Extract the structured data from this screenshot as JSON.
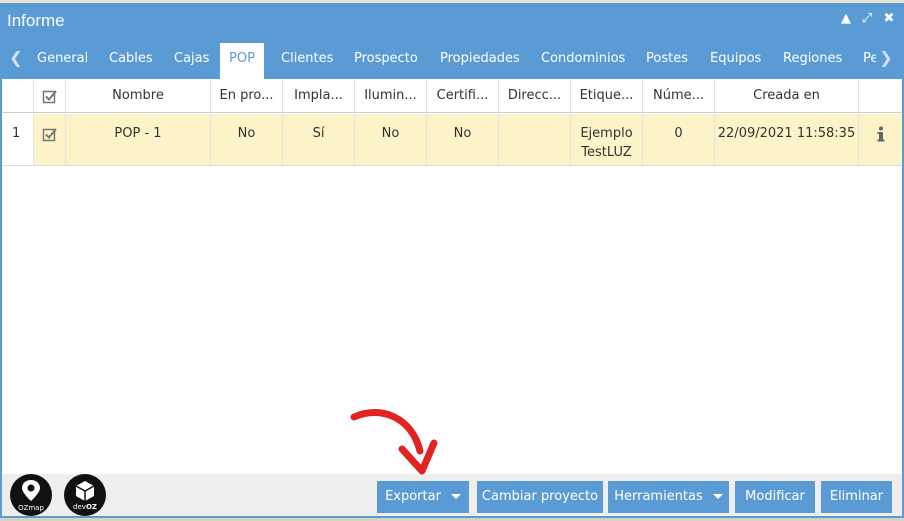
{
  "window": {
    "title": "Informe"
  },
  "tabs": [
    {
      "label": "General"
    },
    {
      "label": "Cables"
    },
    {
      "label": "Cajas"
    },
    {
      "label": "POP"
    },
    {
      "label": "Clientes"
    },
    {
      "label": "Prospecto"
    },
    {
      "label": "Propiedades"
    },
    {
      "label": "Condominios"
    },
    {
      "label": "Postes"
    },
    {
      "label": "Equipos"
    },
    {
      "label": "Regiones"
    },
    {
      "label": "Pe"
    }
  ],
  "table": {
    "columns": [
      "Nombre",
      "En pro...",
      "Impla...",
      "Ilumin...",
      "Certifi...",
      "Direcc...",
      "Etique...",
      "Núme...",
      "Creada en"
    ],
    "rows": [
      {
        "index": "1",
        "nombre": "POP - 1",
        "en_pro": "No",
        "impla": "Sí",
        "ilumin": "No",
        "certifi": "No",
        "direcc": "",
        "etique": "Ejemplo TestLUZ",
        "numero": "0",
        "creada": "22/09/2021 11:58:35"
      }
    ]
  },
  "logos": {
    "ozmap": "OZmap",
    "devoz_prefix": "dev",
    "devoz_suffix": "OZ"
  },
  "buttons": {
    "exportar": "Exportar",
    "cambiar_proyecto": "Cambiar proyecto",
    "herramientas": "Herramientas",
    "modificar": "Modificar",
    "eliminar": "Eliminar"
  },
  "colors": {
    "accent": "#5b9bd5",
    "selected_row": "#fdf3c8",
    "annotation_arrow": "#e32222"
  }
}
